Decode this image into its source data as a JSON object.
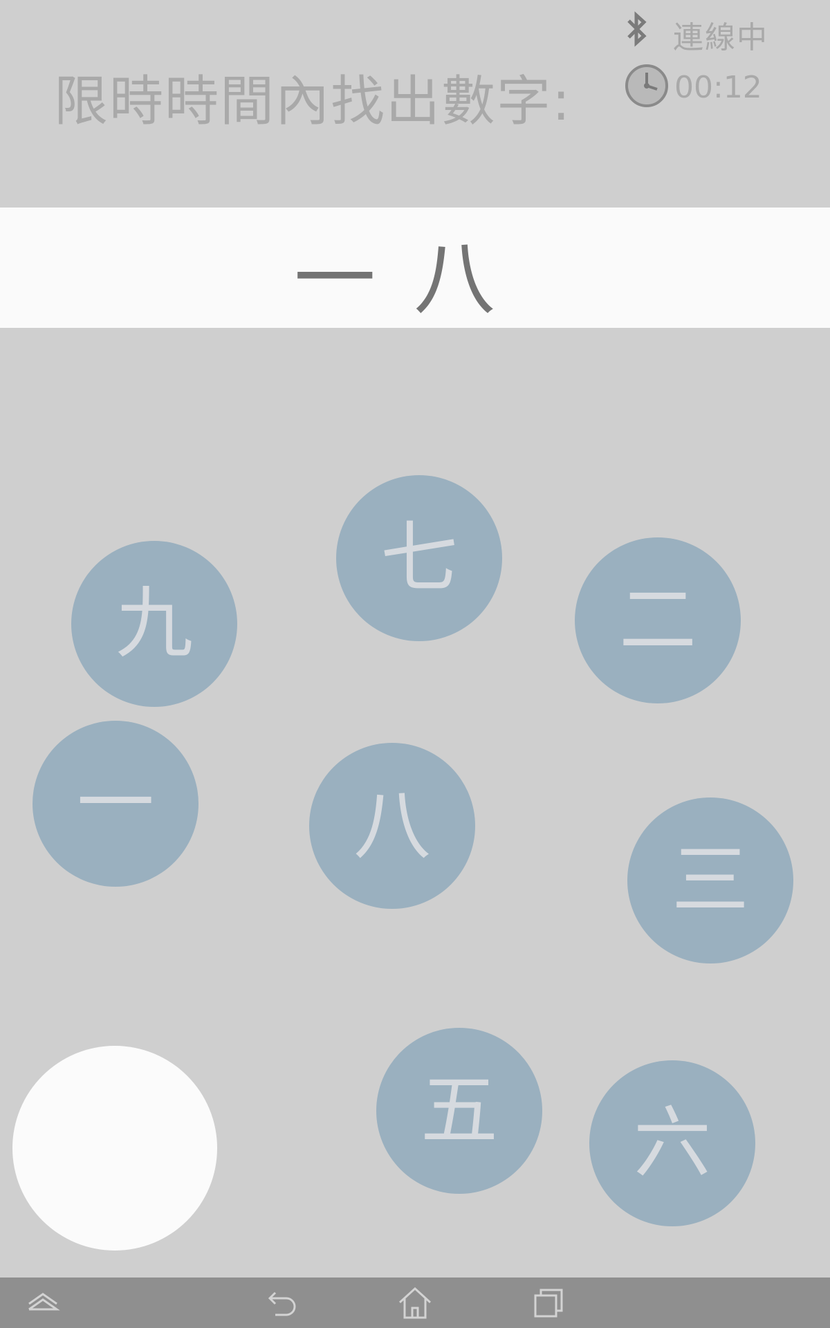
{
  "status_bar": {
    "bluetooth_icon": "bluetooth-icon",
    "connection_status": "連線中"
  },
  "header": {
    "instruction": "限時時間內找出數字:",
    "timer_icon": "clock-icon",
    "timer": "00:12"
  },
  "target": {
    "digits": [
      "一",
      "八"
    ]
  },
  "bubbles": [
    {
      "name": "bubble-qi",
      "label": "七"
    },
    {
      "name": "bubble-jiu",
      "label": "九"
    },
    {
      "name": "bubble-er",
      "label": "二"
    },
    {
      "name": "bubble-yi",
      "label": "一"
    },
    {
      "name": "bubble-ba",
      "label": "八"
    },
    {
      "name": "bubble-san",
      "label": "三"
    },
    {
      "name": "bubble-wu",
      "label": "五"
    },
    {
      "name": "bubble-liu",
      "label": "六"
    }
  ],
  "nav_bar": {
    "icons": [
      "collapse-icon",
      "back-icon",
      "home-icon",
      "recent-apps-icon"
    ]
  },
  "colors": {
    "background": "#cfcfcf",
    "bubble": "#9ab0bf",
    "bubble_text": "#d6dadf",
    "panel": "#fafafa",
    "target_text": "#747474",
    "muted_text": "#a9a9a9",
    "nav_bar": "#8f8f8f"
  }
}
